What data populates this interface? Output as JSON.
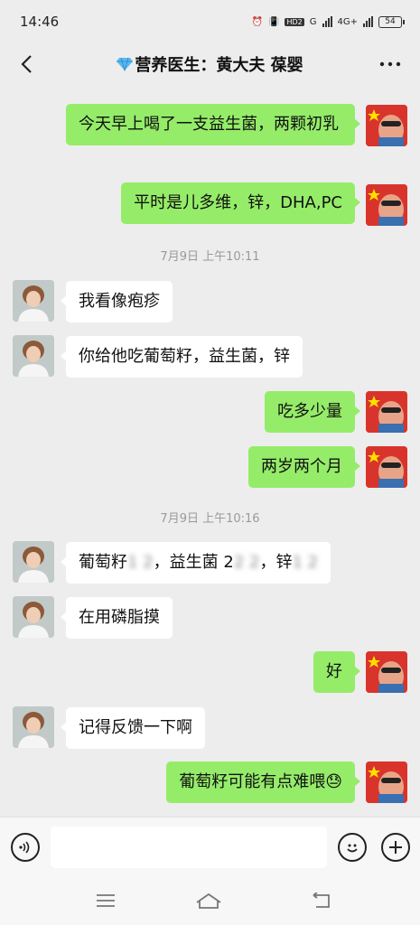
{
  "status_bar": {
    "time": "14:46",
    "hd": "HD2",
    "network_g": "G",
    "network_4g": "4G+",
    "battery": "54"
  },
  "header": {
    "title": "营养医生：黄大夫 葆婴",
    "back_icon": "chevron-left-icon",
    "more_icon": "more-dots-icon",
    "gem_icon": "gem-icon"
  },
  "colors": {
    "bubble_me": "#95ec69",
    "bubble_doc": "#ffffff",
    "background": "#ededed"
  },
  "messages": [
    {
      "type": "msg",
      "from": "me",
      "text": "今天早上喝了一支益生菌，两颗初乳"
    },
    {
      "type": "msg",
      "from": "me",
      "text": "平时是儿多维，锌，DHA,PC"
    },
    {
      "type": "time",
      "text": "7月9日  上午10:11"
    },
    {
      "type": "msg",
      "from": "doc",
      "text": "我看像疱疹"
    },
    {
      "type": "msg",
      "from": "doc",
      "text": "你给他吃葡萄籽，益生菌，锌"
    },
    {
      "type": "msg",
      "from": "me",
      "text": "吃多少量"
    },
    {
      "type": "msg",
      "from": "me",
      "text": "两岁两个月"
    },
    {
      "type": "time",
      "text": "7月9日  上午10:16"
    },
    {
      "type": "msg",
      "from": "doc",
      "parts": [
        "葡萄籽",
        "1 2",
        "，益生菌 2",
        "2 2",
        "，锌",
        "1 2"
      ]
    },
    {
      "type": "msg",
      "from": "doc",
      "text": "在用磷脂摸"
    },
    {
      "type": "msg",
      "from": "me",
      "text": "好"
    },
    {
      "type": "msg",
      "from": "doc",
      "text": "记得反馈一下啊"
    },
    {
      "type": "msg",
      "from": "me",
      "text": "葡萄籽可能有点难喂",
      "emoji": "😓"
    }
  ],
  "input_bar": {
    "placeholder": "",
    "voice_icon": "voice-icon",
    "emoji_icon": "emoji-icon",
    "plus_icon": "plus-icon"
  },
  "nav_bar": {
    "menu_icon": "menu-icon",
    "home_icon": "home-icon",
    "back_icon": "back-icon"
  }
}
